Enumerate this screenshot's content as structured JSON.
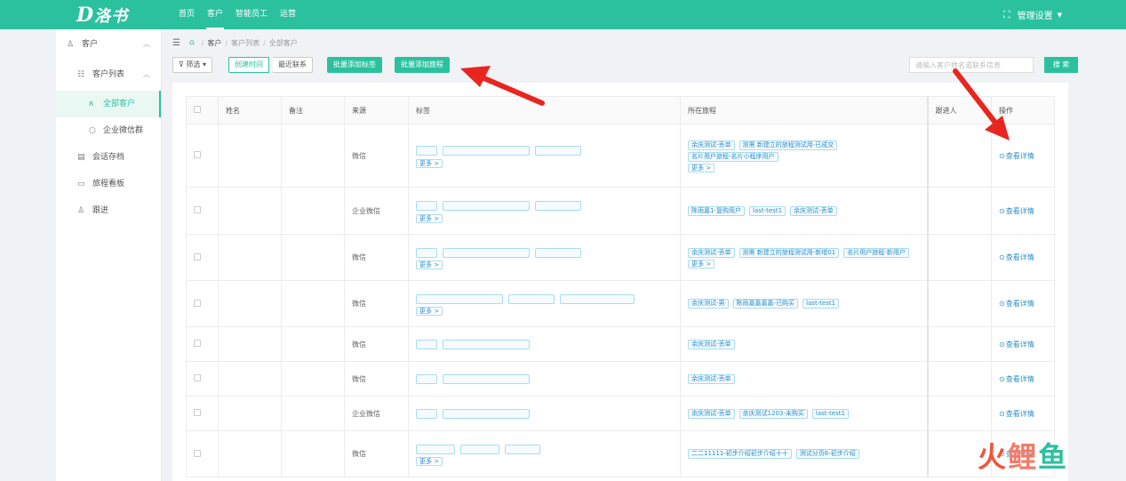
{
  "app": {
    "logo_mark": "D",
    "logo_text": "洛书"
  },
  "topnav": [
    {
      "label": "首页",
      "active": false
    },
    {
      "label": "客户",
      "active": true
    },
    {
      "label": "智能员工",
      "active": false
    },
    {
      "label": "运营",
      "active": false
    }
  ],
  "topright": {
    "settings_label": "管理设置"
  },
  "sidebar": {
    "customer": "客户",
    "customer_list": "客户列表",
    "all_customers": "全部客户",
    "wecom_groups": "企业微信群",
    "chat_archive": "会话存档",
    "journey_board": "旅程看板",
    "follow_up": "跟进"
  },
  "breadcrumb": {
    "level1": "客户",
    "level2": "客户列表",
    "level3": "全部客户"
  },
  "toolbar": {
    "filter_label": "筛选",
    "sort_created": "创建时间",
    "sort_recent": "最近联系",
    "batch_tag": "批量添加标签",
    "batch_journey": "批量添加旅程",
    "search_placeholder": "请输入客户姓名或联系信息",
    "search_button": "搜 索"
  },
  "table": {
    "columns": {
      "name": "姓名",
      "remark": "备注",
      "source": "来源",
      "tags": "标签",
      "journey": "所在旅程",
      "follower": "跟进人",
      "ops": "操作"
    },
    "more_label": "更多 >",
    "action_label": "查看详情",
    "rows": [
      {
        "source": "微信",
        "journeys": [
          "余庆测试-丢单",
          "测需 新建立的旅程测试用-已成交",
          "名片用户旅程-名片小程序用户"
        ],
        "has_more": true
      },
      {
        "source": "企业微信",
        "journeys": [
          "陈雨嘉1-复购用户",
          "last-test1",
          "余庆测试-丢单"
        ],
        "has_more": false
      },
      {
        "source": "微信",
        "journeys": [
          "余庆测试-丢单",
          "测需 新建立的旅程测试用-新增01",
          "名片用户旅程-新用户"
        ],
        "has_more": true
      },
      {
        "source": "微信",
        "journeys": [
          "余庆测试-男",
          "陈雨嘉嘉嘉嘉-已购买",
          "last-test1"
        ],
        "has_more": false
      },
      {
        "source": "微信",
        "journeys": [
          "余庆测试-丢单"
        ],
        "has_more": false
      },
      {
        "source": "微信",
        "journeys": [
          "余庆测试-丢单"
        ],
        "has_more": false
      },
      {
        "source": "企业微信",
        "journeys": [
          "余庆测试-丢单",
          "余庆测试1203-未购买",
          "last-test1"
        ],
        "has_more": false
      },
      {
        "source": "微信",
        "journeys": [
          "二二11111-初步介绍初步介绍十十",
          "测试分页6-初步介绍"
        ],
        "has_more": false
      }
    ]
  },
  "watermark": {
    "part1": "火",
    "part2": "鲤",
    "part3": "鱼"
  },
  "colors": {
    "brand": "#2bc19f",
    "link": "#2b8fc9",
    "arrow": "#e8261f"
  },
  "icons": [
    "user-icon",
    "list-icon",
    "group-icon",
    "chat-bubble-icon",
    "archive-icon",
    "board-icon",
    "follow-icon",
    "home-icon",
    "filter-icon",
    "expand-icon",
    "eye-icon"
  ]
}
